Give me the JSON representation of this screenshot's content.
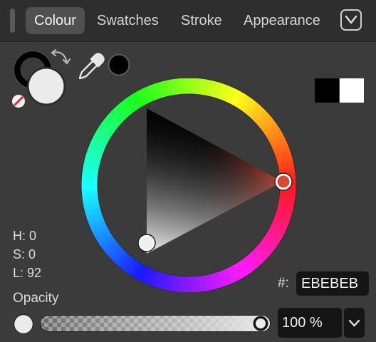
{
  "tabs": [
    {
      "label": "Colour",
      "active": true
    },
    {
      "label": "Swatches",
      "active": false
    },
    {
      "label": "Stroke",
      "active": false
    },
    {
      "label": "Appearance",
      "active": false
    }
  ],
  "tab_menu_icon": "chevron-down-icon",
  "fill_color": "#EBEBEB",
  "stroke_color": "#000000",
  "picker_current_color": "#000000",
  "swatch_pair": [
    "#000000",
    "#FFFFFF"
  ],
  "hsl": {
    "h_label": "H:",
    "h_value": "0",
    "s_label": "S:",
    "s_value": "0",
    "l_label": "L:",
    "l_value": "92"
  },
  "hex": {
    "prefix": "#:",
    "value": "EBEBEB"
  },
  "opacity": {
    "label": "Opacity",
    "value_text": "100 %",
    "level": 1.0
  },
  "hue_marker_color": "#d64a36"
}
